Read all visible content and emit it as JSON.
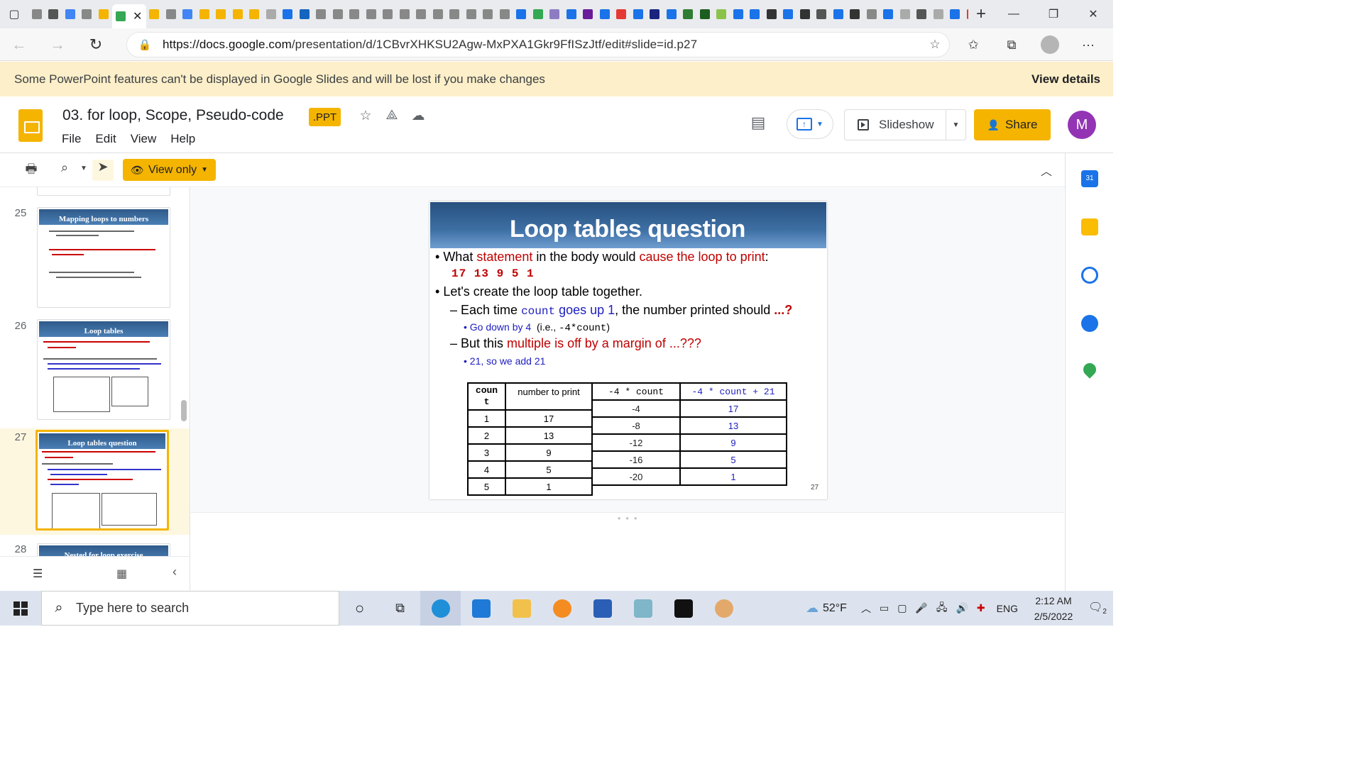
{
  "browser": {
    "url_host": "https://docs.google.com",
    "url_path": "/presentation/d/1CBvrXHKSU2Agw-MxPXA1Gkr9FfISzJtf/edit#slide=id.p27"
  },
  "banner": {
    "text": "Some PowerPoint features can't be displayed in Google Slides and will be lost if you make changes",
    "action": "View details"
  },
  "doc": {
    "title": "03. for loop, Scope, Pseudo-code",
    "badge": ".PPT",
    "menus": [
      "File",
      "Edit",
      "View",
      "Help"
    ],
    "slideshow_label": "Slideshow",
    "share_label": "Share",
    "avatar_letter": "M"
  },
  "toolbar": {
    "view_only_label": "View only"
  },
  "filmstrip": {
    "slides": [
      {
        "number": "25",
        "title": "Mapping loops to numbers"
      },
      {
        "number": "26",
        "title": "Loop tables"
      },
      {
        "number": "27",
        "title": "Loop tables question"
      },
      {
        "number": "28",
        "title": "Nested for loop exercise"
      }
    ]
  },
  "slide": {
    "title": "Loop tables question",
    "b1_pre": "What ",
    "b1_statement": "statement",
    "b1_mid": " in the body would ",
    "b1_cause": "cause the loop to print",
    "b1_colon": ":",
    "output": "17  13  9  5  1",
    "b2": "Let's create the loop table together.",
    "s1_pre": "Each time ",
    "s1_count": "count",
    "s1_goes": " goes up 1",
    "s1_mid": ", the number printed should ",
    "s1_q": "...?",
    "ss1_text": "Go down by 4",
    "ss1_paren": "(i.e., ",
    "ss1_code": "-4*count",
    "ss1_close": ")",
    "s2_pre": "But this ",
    "s2_red": "multiple is off by a margin of ...???",
    "ss2_text": "21, so we add 21",
    "page_num": "27",
    "left_table": {
      "headers": [
        "coun\nt",
        "number to print"
      ],
      "rows": [
        [
          "1",
          "17"
        ],
        [
          "2",
          "13"
        ],
        [
          "3",
          "9"
        ],
        [
          "4",
          "5"
        ],
        [
          "5",
          "1"
        ]
      ]
    },
    "right_table": {
      "headers": [
        "-4 * count",
        "-4 * count + 21"
      ],
      "rows": [
        [
          "-4",
          "17"
        ],
        [
          "-8",
          "13"
        ],
        [
          "-12",
          "9"
        ],
        [
          "-16",
          "5"
        ],
        [
          "-20",
          "1"
        ]
      ]
    }
  },
  "taskbar": {
    "search_placeholder": "Type here to search",
    "weather": "52°F",
    "lang": "ENG",
    "time": "2:12 AM",
    "date": "2/5/2022",
    "notif_count": "2"
  },
  "colors": {
    "accent": "#f4b400",
    "slide_title_bg": "#2f5a8a",
    "red_text": "#c00000",
    "blue_text": "#2020c0",
    "avatar": "#9334b5"
  }
}
